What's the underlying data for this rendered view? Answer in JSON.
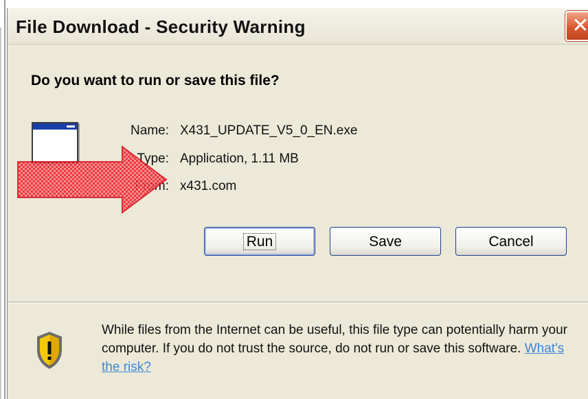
{
  "dialog": {
    "title": "File Download - Security Warning",
    "close_label": "✕",
    "question": "Do you want to run or save this file?",
    "file": {
      "name_label": "Name:",
      "name_value": "X431_UPDATE_V5_0_EN.exe",
      "type_label": "Type:",
      "type_value": "Application, 1.11 MB",
      "from_label": "From:",
      "from_value": "x431.com"
    },
    "buttons": {
      "run": "Run",
      "save": "Save",
      "cancel": "Cancel"
    },
    "warning": {
      "text": "While files from the Internet can be useful, this file type can potentially harm your computer. If you do not trust the source, do not run or save this software.",
      "link": "What's the risk?"
    }
  },
  "icons": [
    "application-file-icon",
    "security-shield-icon",
    "close-icon",
    "arrow-annotation-icon"
  ],
  "colors": {
    "dialog_bg": "#ece9d8",
    "close_button": "#d9582f",
    "link": "#3d86d6",
    "arrow": "#e8101a",
    "shield": "#f3c80a"
  }
}
